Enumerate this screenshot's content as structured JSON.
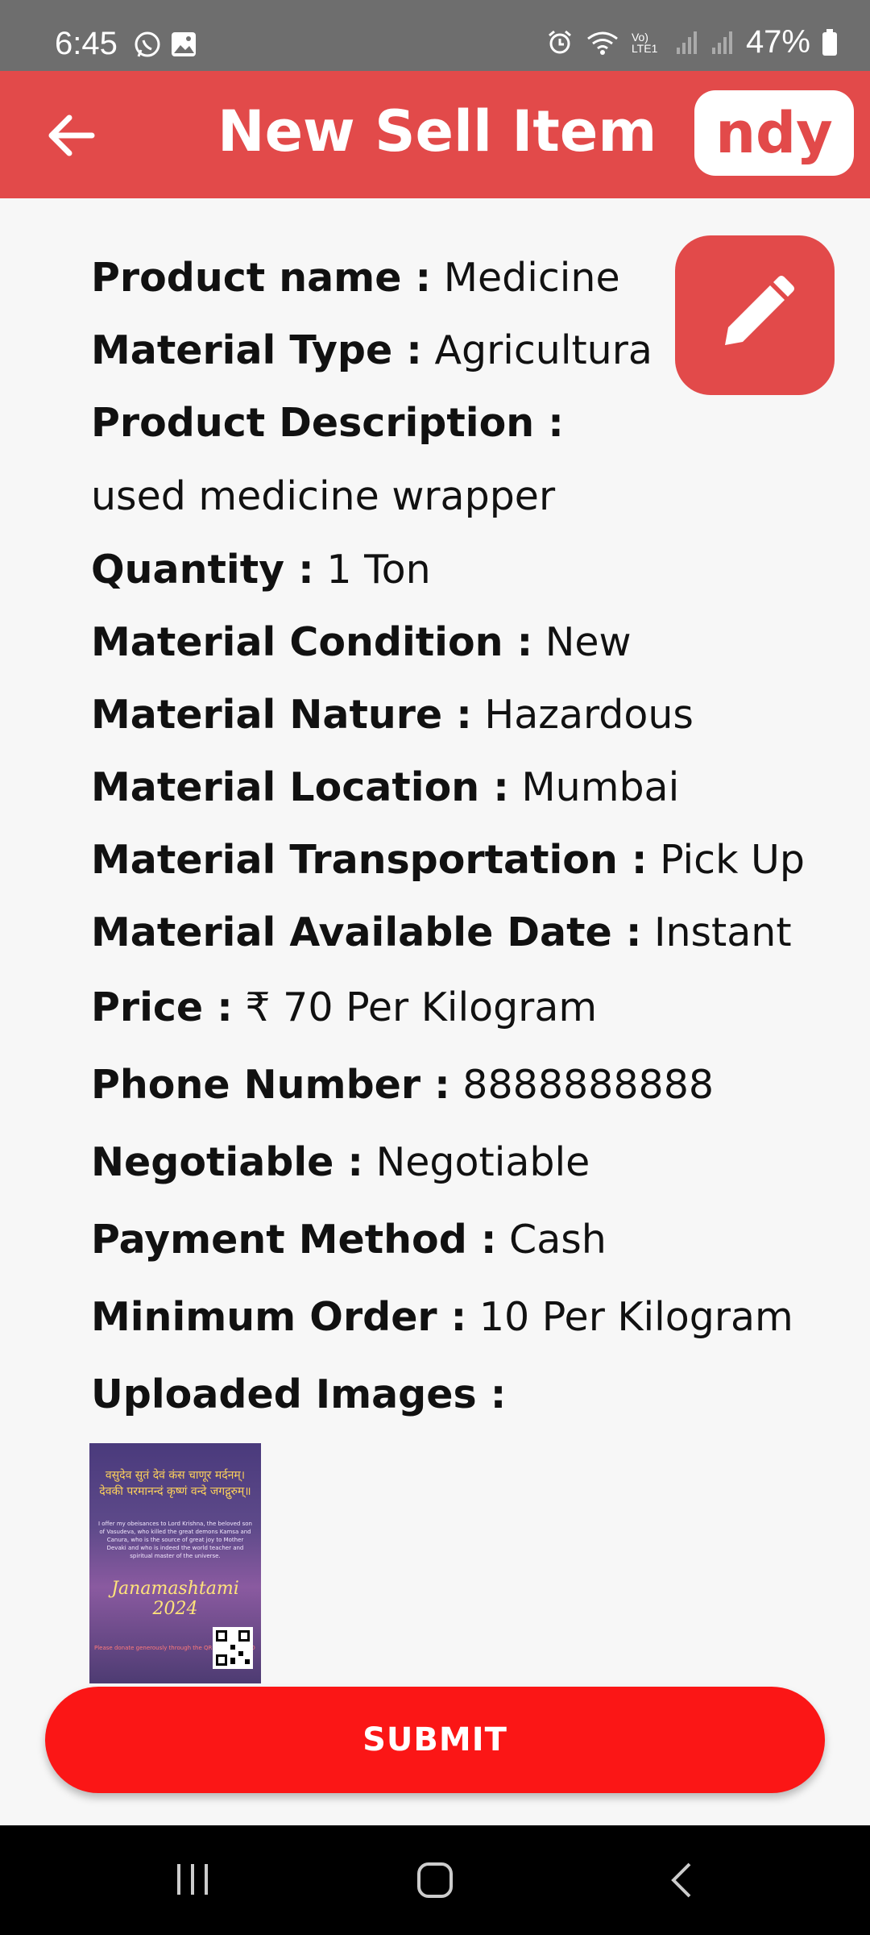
{
  "status_bar": {
    "time": "6:45",
    "left_icons": [
      "whatsapp-icon",
      "gallery-icon"
    ],
    "right_icons": [
      "alarm-icon",
      "wifi-icon",
      "volte-icon",
      "signal-icon",
      "signal-icon",
      "battery-icon"
    ],
    "volte_label": "Vo) LTE1",
    "battery": "47%"
  },
  "app_bar": {
    "title": "New Sell Item",
    "brand": "ndy",
    "back_icon": "arrow-left-icon"
  },
  "edit_button": {
    "icon": "pencil-icon"
  },
  "details": {
    "product_name": {
      "label": "Product name :",
      "value": "Medicine"
    },
    "material_type": {
      "label": "Material Type :",
      "value": "Agricultura"
    },
    "product_description": {
      "label": "Product Description :",
      "value": "used medicine wrapper"
    },
    "quantity": {
      "label": "Quantity :",
      "value": "1 Ton"
    },
    "material_condition": {
      "label": "Material Condition :",
      "value": "New"
    },
    "material_nature": {
      "label": "Material Nature :",
      "value": "Hazardous"
    },
    "material_location": {
      "label": "Material Location :",
      "value": "Mumbai"
    },
    "material_transportation": {
      "label": "Material Transportation :",
      "value": "Pick Up"
    },
    "material_available_date": {
      "label": "Material Available Date :",
      "value": "Instant"
    },
    "price": {
      "label": "Price :",
      "value": "₹ 70 Per Kilogram"
    },
    "phone_number": {
      "label": "Phone Number :",
      "value": "8888888888"
    },
    "negotiable": {
      "label": "Negotiable :",
      "value": "Negotiable"
    },
    "payment_method": {
      "label": "Payment Method :",
      "value": "Cash"
    },
    "minimum_order": {
      "label": "Minimum Order :",
      "value": "10 Per Kilogram"
    },
    "uploaded_images": {
      "label": "Uploaded Images :"
    }
  },
  "uploaded_image": {
    "heading": "वसुदेव सुतं देवं कंस चाणूर मर्दनम्। देवकी परमानन्दं कृष्णं वन्दे जगद्गुरुम्॥",
    "body": "I offer my obeisances to Lord Krishna, the beloved son of Vasudeva, who killed the great demons Kamsa and Canura, who is the source of great joy to Mother Devaki and who is indeed the world teacher and spiritual master of the universe.",
    "title": "Janamashtami 2024",
    "footer": "Please donate generously through the QR code on UPI ID"
  },
  "submit_button": {
    "label": "SUBMIT"
  },
  "nav_bar": {
    "icons": [
      "recent-apps-icon",
      "home-icon",
      "back-icon"
    ]
  },
  "colors": {
    "app_bar": "#e24a4a",
    "submit": "#fb1616",
    "status_bar": "#6e6e6e",
    "background": "#f7f7f7"
  }
}
